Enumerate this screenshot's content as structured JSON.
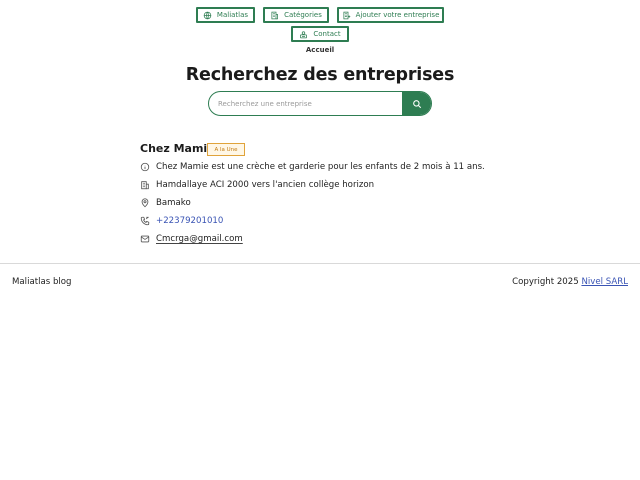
{
  "nav": {
    "home": "Maliatlas",
    "categories": "Catégories",
    "add_business": "Ajouter votre entreprise",
    "contact": "Contact"
  },
  "breadcrumb": "Accueil",
  "page_title": "Recherchez des entreprises",
  "search": {
    "placeholder": "Recherchez une entreprise",
    "value": ""
  },
  "business": {
    "name": "Chez Mamie",
    "badge": "A la Une",
    "description": "Chez Mamie est une crèche et garderie pour les enfants de 2 mois à 11 ans.",
    "address": "Hamdallaye ACI 2000 vers l'ancien collège horizon",
    "city": "Bamako",
    "phone": "+22379201010",
    "email": "Cmcrga@gmail.com"
  },
  "footer": {
    "left": "Maliatlas blog",
    "copyright": "Copyright 2025",
    "company": "Nivel SARL"
  },
  "colors": {
    "accent": "#2e7d52",
    "link": "#3a54b4",
    "badge_border": "#e0a33a"
  },
  "icons": [
    "globe-icon",
    "building-icon",
    "building-add-icon",
    "contact-icon",
    "search-icon",
    "info-icon",
    "building-icon",
    "map-pin-icon",
    "phone-icon",
    "mail-icon"
  ]
}
